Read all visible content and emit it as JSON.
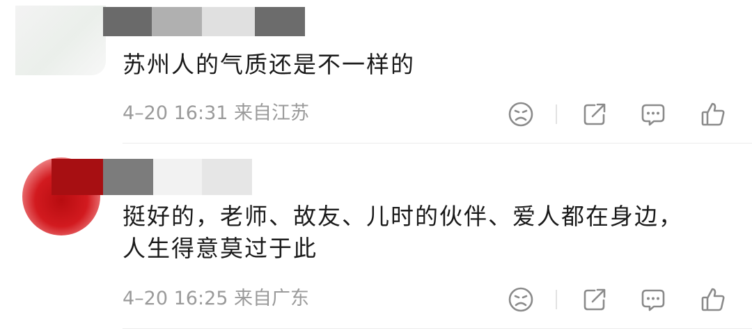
{
  "comments": [
    {
      "text_lines": [
        "苏州人的气质还是不一样的"
      ],
      "time": "4–20 16:31",
      "location": "来自江苏",
      "blur_colors": [
        "#6a6a6a",
        "#b0b0b0",
        "#e0e0e0",
        "#6c6c6c"
      ]
    },
    {
      "text_lines": [
        "挺好的，老师、故友、儿时的伙伴、爱人都在身边，",
        "人生得意莫过于此"
      ],
      "time": "4–20 16:25",
      "location": "来自广东",
      "blur_colors": [
        "#a70f12",
        "#7c7c7c",
        "#f2f2f2",
        "#e6e6e6"
      ]
    }
  ],
  "icons": [
    "sad-face-icon",
    "share-icon",
    "comment-icon",
    "thumbs-up-icon"
  ],
  "colors": {
    "text": "#1a1a1a",
    "meta": "#9a9a9a",
    "icon": "#8a8a8a"
  }
}
